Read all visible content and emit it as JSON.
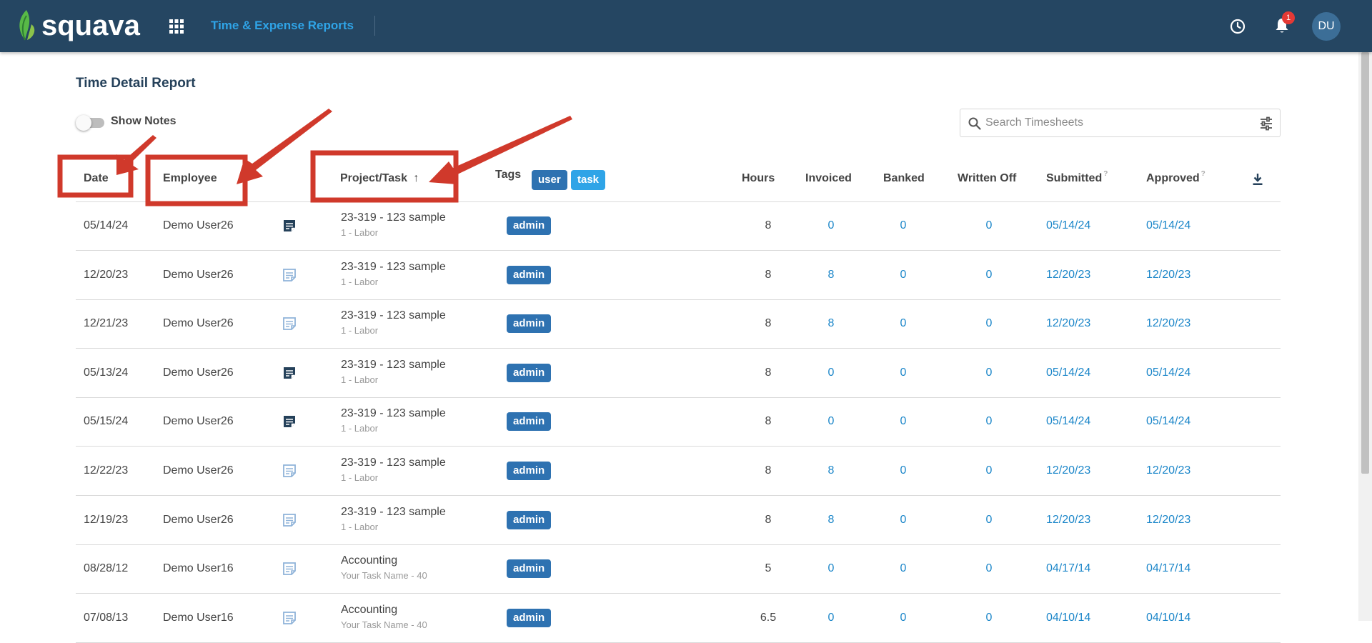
{
  "header": {
    "logo_text": "squava",
    "app_title": "Time & Expense Reports",
    "notification_count": "1",
    "avatar_initials": "DU",
    "brand_color": "#254662",
    "accent_color": "#2fa4e7"
  },
  "page": {
    "title": "Time Detail Report",
    "show_notes_label": "Show Notes",
    "show_notes_on": false,
    "search_placeholder": "Search Timesheets"
  },
  "columns": {
    "date": "Date",
    "employee": "Employee",
    "project_task": "Project/Task",
    "sort_arrow": "↑",
    "tags": "Tags",
    "tag_filters": [
      "user",
      "task"
    ],
    "hours": "Hours",
    "invoiced": "Invoiced",
    "banked": "Banked",
    "written_off": "Written Off",
    "submitted": "Submitted",
    "approved": "Approved",
    "help_mark": "?"
  },
  "rows": [
    {
      "date": "05/14/24",
      "employee": "Demo User26",
      "note": "filled",
      "project": "23-319 - 123 sample",
      "task": "1 - Labor",
      "tag": "admin",
      "hours": "8",
      "invoiced": "0",
      "banked": "0",
      "written_off": "0",
      "submitted": "05/14/24",
      "approved": "05/14/24"
    },
    {
      "date": "12/20/23",
      "employee": "Demo User26",
      "note": "outline",
      "project": "23-319 - 123 sample",
      "task": "1 - Labor",
      "tag": "admin",
      "hours": "8",
      "invoiced": "8",
      "banked": "0",
      "written_off": "0",
      "submitted": "12/20/23",
      "approved": "12/20/23"
    },
    {
      "date": "12/21/23",
      "employee": "Demo User26",
      "note": "outline",
      "project": "23-319 - 123 sample",
      "task": "1 - Labor",
      "tag": "admin",
      "hours": "8",
      "invoiced": "8",
      "banked": "0",
      "written_off": "0",
      "submitted": "12/20/23",
      "approved": "12/20/23"
    },
    {
      "date": "05/13/24",
      "employee": "Demo User26",
      "note": "filled",
      "project": "23-319 - 123 sample",
      "task": "1 - Labor",
      "tag": "admin",
      "hours": "8",
      "invoiced": "0",
      "banked": "0",
      "written_off": "0",
      "submitted": "05/14/24",
      "approved": "05/14/24"
    },
    {
      "date": "05/15/24",
      "employee": "Demo User26",
      "note": "filled",
      "project": "23-319 - 123 sample",
      "task": "1 - Labor",
      "tag": "admin",
      "hours": "8",
      "invoiced": "0",
      "banked": "0",
      "written_off": "0",
      "submitted": "05/14/24",
      "approved": "05/14/24"
    },
    {
      "date": "12/22/23",
      "employee": "Demo User26",
      "note": "outline",
      "project": "23-319 - 123 sample",
      "task": "1 - Labor",
      "tag": "admin",
      "hours": "8",
      "invoiced": "8",
      "banked": "0",
      "written_off": "0",
      "submitted": "12/20/23",
      "approved": "12/20/23"
    },
    {
      "date": "12/19/23",
      "employee": "Demo User26",
      "note": "outline",
      "project": "23-319 - 123 sample",
      "task": "1 - Labor",
      "tag": "admin",
      "hours": "8",
      "invoiced": "8",
      "banked": "0",
      "written_off": "0",
      "submitted": "12/20/23",
      "approved": "12/20/23"
    },
    {
      "date": "08/28/12",
      "employee": "Demo User16",
      "note": "outline",
      "project": "Accounting",
      "task": "Your Task Name - 40",
      "tag": "admin",
      "hours": "5",
      "invoiced": "0",
      "banked": "0",
      "written_off": "0",
      "submitted": "04/17/14",
      "approved": "04/17/14"
    },
    {
      "date": "07/08/13",
      "employee": "Demo User16",
      "note": "outline",
      "project": "Accounting",
      "task": "Your Task Name - 40",
      "tag": "admin",
      "hours": "6.5",
      "invoiced": "0",
      "banked": "0",
      "written_off": "0",
      "submitted": "04/10/14",
      "approved": "04/10/14"
    }
  ],
  "colors": {
    "link_blue": "#1b86c9",
    "tag_admin": "#2e72b1",
    "tag_user": "#2e72b1",
    "tag_task": "#2fa4e7",
    "annotation_red": "#d0392b"
  }
}
